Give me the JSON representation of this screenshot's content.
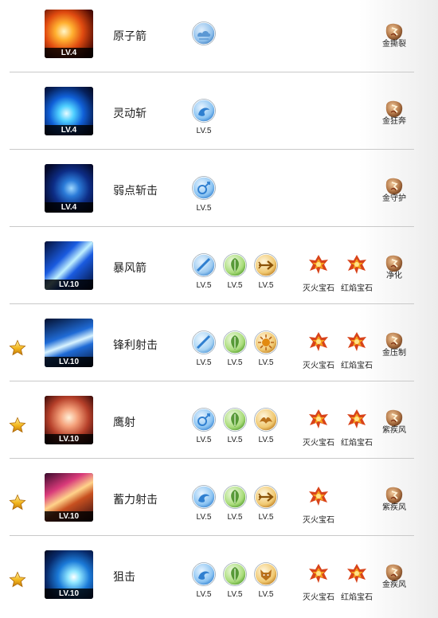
{
  "skills": [
    {
      "name": "原子箭",
      "level": "LV.4",
      "starred": false,
      "art": "fire-burst",
      "runes": [
        {
          "icon": "cloud-rune",
          "level": ""
        }
      ],
      "gems": [],
      "amulet": {
        "label": "金撕裂",
        "icon": "tear-amulet"
      }
    },
    {
      "name": "灵动斩",
      "level": "LV.4",
      "starred": false,
      "art": "blue-swirl",
      "runes": [
        {
          "icon": "wave-rune",
          "level": "LV.5"
        }
      ],
      "gems": [],
      "amulet": {
        "label": "金狂奔",
        "icon": "rush-amulet"
      }
    },
    {
      "name": "弱点斩击",
      "level": "LV.4",
      "starred": false,
      "art": "dark-blue-vortex",
      "runes": [
        {
          "icon": "link-rune",
          "level": "LV.5"
        }
      ],
      "gems": [],
      "amulet": {
        "label": "金守护",
        "icon": "guard-amulet"
      }
    },
    {
      "name": "暴风箭",
      "level": "LV.10",
      "starred": false,
      "art": "blue-arrow-storm",
      "runes": [
        {
          "icon": "blade-rune",
          "level": "LV.5"
        },
        {
          "icon": "leaf-rune",
          "level": "LV.5"
        },
        {
          "icon": "arrow-rune",
          "level": "LV.5"
        }
      ],
      "gems": [
        {
          "label": "灭火宝石",
          "icon": "fire-gem"
        },
        {
          "label": "红焰宝石",
          "icon": "red-flame-gem"
        }
      ],
      "amulet": {
        "label": "净化",
        "icon": "purify-amulet"
      }
    },
    {
      "name": "锋利射击",
      "level": "LV.10",
      "starred": true,
      "art": "sharp-shot",
      "runes": [
        {
          "icon": "slash-rune",
          "level": "LV.5"
        },
        {
          "icon": "clover-rune",
          "level": "LV.5"
        },
        {
          "icon": "sun-rune",
          "level": "LV.5"
        }
      ],
      "gems": [
        {
          "label": "灭火宝石",
          "icon": "fire-gem"
        },
        {
          "label": "红焰宝石",
          "icon": "red-flame-gem"
        }
      ],
      "amulet": {
        "label": "金压制",
        "icon": "suppress-amulet"
      }
    },
    {
      "name": "鹰射",
      "level": "LV.10",
      "starred": true,
      "art": "hawk-shot",
      "runes": [
        {
          "icon": "link-rune",
          "level": "LV.5"
        },
        {
          "icon": "leaf-rune",
          "level": "LV.5"
        },
        {
          "icon": "bird-rune",
          "level": "LV.5"
        }
      ],
      "gems": [
        {
          "label": "灭火宝石",
          "icon": "fire-gem"
        },
        {
          "label": "红焰宝石",
          "icon": "red-flame-gem"
        }
      ],
      "amulet": {
        "label": "紫疾风",
        "icon": "gale-amulet"
      }
    },
    {
      "name": "蓄力射击",
      "level": "LV.10",
      "starred": true,
      "art": "charged-shot",
      "runes": [
        {
          "icon": "wave-rune",
          "level": "LV.5"
        },
        {
          "icon": "leaf-rune",
          "level": "LV.5"
        },
        {
          "icon": "arrow-rune",
          "level": "LV.5"
        }
      ],
      "gems": [
        {
          "label": "灭火宝石",
          "icon": "fire-gem"
        }
      ],
      "amulet": {
        "label": "紫疾风",
        "icon": "gale-amulet"
      }
    },
    {
      "name": "狙击",
      "level": "LV.10",
      "starred": true,
      "art": "snipe",
      "runes": [
        {
          "icon": "wave-rune",
          "level": "LV.5"
        },
        {
          "icon": "clover-rune",
          "level": "LV.5"
        },
        {
          "icon": "wolf-rune",
          "level": "LV.5"
        }
      ],
      "gems": [
        {
          "label": "灭火宝石",
          "icon": "fire-gem"
        },
        {
          "label": "红焰宝石",
          "icon": "red-flame-gem"
        }
      ],
      "amulet": {
        "label": "金疾风",
        "icon": "gale-amulet"
      }
    }
  ]
}
